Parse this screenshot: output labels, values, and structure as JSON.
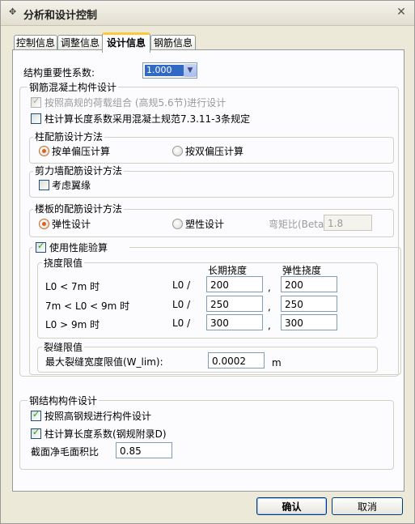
{
  "window": {
    "title": "分析和设计控制",
    "close_icon": "close-icon"
  },
  "tabs": [
    {
      "label": "控制信息"
    },
    {
      "label": "调整信息"
    },
    {
      "label": "设计信息",
      "active": true
    },
    {
      "label": "钢筋信息"
    }
  ],
  "importance": {
    "label": "结构重要性系数:",
    "value": "1.000"
  },
  "rc_design": {
    "title": "钢筋混凝土构件设计",
    "high_rule_label": "按照高规的荷载组合 (高规5.6节)进行设计",
    "high_rule_checked": true,
    "high_rule_enabled": false,
    "column_length_label": "柱计算长度系数采用混凝土规范7.3.11-3条规定",
    "column_length_checked": false,
    "column_method": {
      "title": "柱配筋设计方法",
      "uniaxial_label": "按单偏压计算",
      "biaxial_label": "按双偏压计算",
      "selected": "uniaxial"
    },
    "shear_wall": {
      "title": "剪力墙配筋设计方法",
      "flange_label": "考虑翼缘",
      "flange_checked": false
    },
    "slab": {
      "title": "楼板的配筋设计方法",
      "elastic_label": "弹性设计",
      "plastic_label": "塑性设计",
      "selected": "elastic",
      "beta_label": "弯矩比(Beta)",
      "beta_value": "1.8"
    },
    "performance": {
      "label": "使用性能验算",
      "checked": true,
      "deflection": {
        "title": "挠度限值",
        "col_long": "长期挠度",
        "col_elastic": "弹性挠度",
        "rows": [
          {
            "range": "L0 < 7m 时",
            "prefix": "L0 /",
            "sep": ",",
            "long": "200",
            "elastic": "200"
          },
          {
            "range": "7m < L0 < 9m 时",
            "prefix": "L0 /",
            "sep": ",",
            "long": "250",
            "elastic": "250"
          },
          {
            "range": "L0 > 9m 时",
            "prefix": "L0 /",
            "sep": ",",
            "long": "300",
            "elastic": "300"
          }
        ]
      },
      "crack": {
        "title": "裂缝限值",
        "label": "最大裂缝宽度限值(W_lim):",
        "value": "0.0002",
        "unit": "m"
      }
    }
  },
  "steel_design": {
    "title": "钢结构构件设计",
    "high_steel_label": "按照高钢规进行构件设计",
    "high_steel_checked": true,
    "column_length_label": "柱计算长度系数(钢规附录D)",
    "column_length_checked": true,
    "net_area_label": "截面净毛面积比",
    "net_area_value": "0.85"
  },
  "buttons": {
    "ok": "确认",
    "cancel": "取消"
  }
}
